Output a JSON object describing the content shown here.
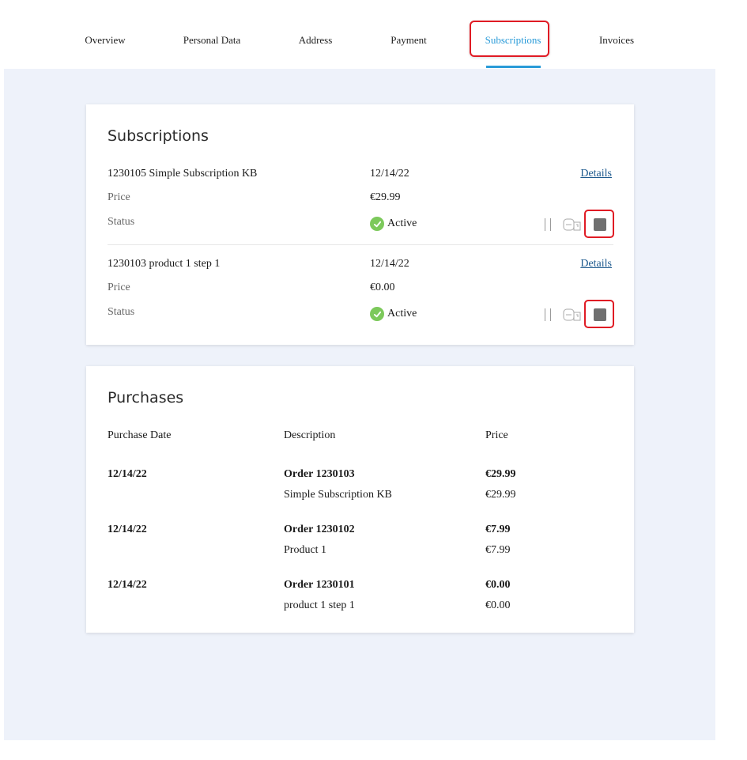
{
  "tabs": [
    {
      "label": "Overview"
    },
    {
      "label": "Personal Data"
    },
    {
      "label": "Address"
    },
    {
      "label": "Payment"
    },
    {
      "label": "Subscriptions"
    },
    {
      "label": "Invoices"
    }
  ],
  "subscriptions": {
    "title": "Subscriptions",
    "price_label": "Price",
    "status_label": "Status",
    "details_label": "Details",
    "items": [
      {
        "name": "1230105 Simple Subscription KB",
        "date": "12/14/22",
        "price": "€29.99",
        "status": "Active"
      },
      {
        "name": "1230103 product 1 step 1",
        "date": "12/14/22",
        "price": "€0.00",
        "status": "Active"
      }
    ]
  },
  "purchases": {
    "title": "Purchases",
    "headers": {
      "date": "Purchase Date",
      "description": "Description",
      "price": "Price"
    },
    "orders": [
      {
        "date": "12/14/22",
        "order": "Order 1230103",
        "total": "€29.99",
        "item": "Simple Subscription KB",
        "item_price": "€29.99"
      },
      {
        "date": "12/14/22",
        "order": "Order 1230102",
        "total": "€7.99",
        "item": "Product 1",
        "item_price": "€7.99"
      },
      {
        "date": "12/14/22",
        "order": "Order 1230101",
        "total": "€0.00",
        "item": "product 1 step 1",
        "item_price": "€0.00"
      }
    ]
  },
  "colors": {
    "accent": "#2a9bd8",
    "highlight": "#e01b24",
    "active": "#7cc95b",
    "background": "#eef2fa"
  }
}
